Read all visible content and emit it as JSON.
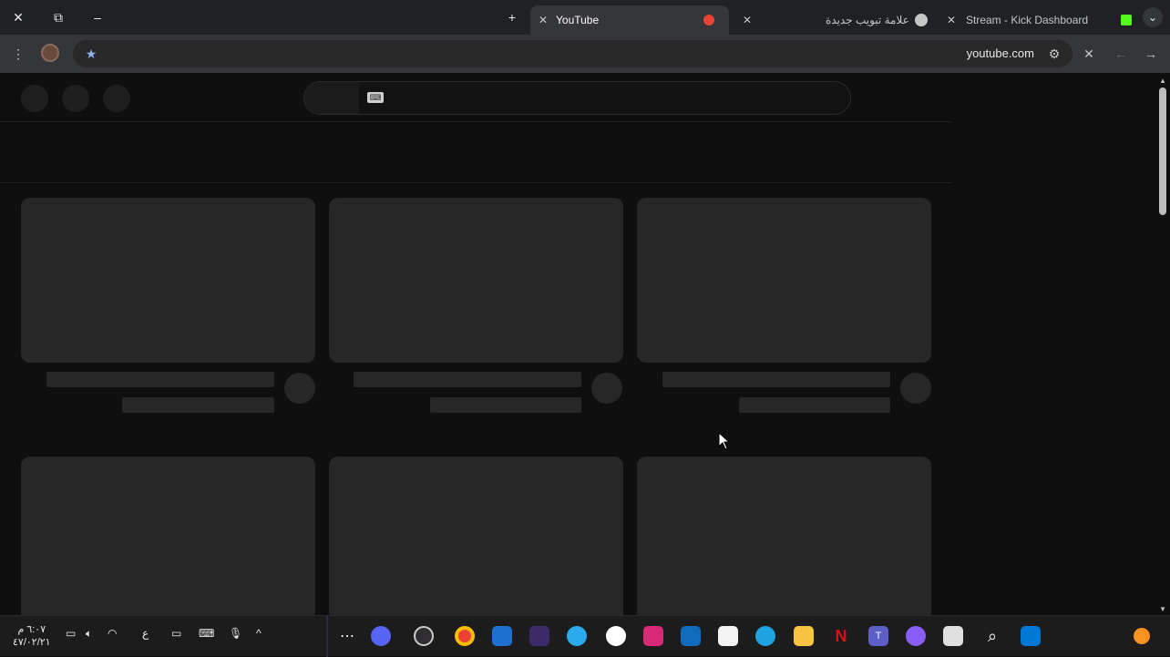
{
  "tabs": [
    {
      "title": "YouTube",
      "active": true
    },
    {
      "title": "علامة تبويب جديدة",
      "active": false
    },
    {
      "title": "Stream - Kick Dashboard",
      "active": false
    }
  ],
  "toolbar": {
    "url": "youtube.com"
  },
  "clock": {
    "time": "٦:٠٧ م",
    "date": "٤٧/٠٢/٢١"
  },
  "tray": {
    "lang": "ع"
  },
  "icons": {
    "close": "✕",
    "restore": "⧉",
    "minimize": "–",
    "newtab": "+",
    "menu": "⋮",
    "star": "★",
    "back": "←",
    "forward": "→",
    "settings": "⚙",
    "chevron": "⌄",
    "search": "⌕"
  },
  "colors": {
    "kick": "#53fc18",
    "chrome_red": "#ea4335",
    "youtube_red": "#ff0000"
  }
}
